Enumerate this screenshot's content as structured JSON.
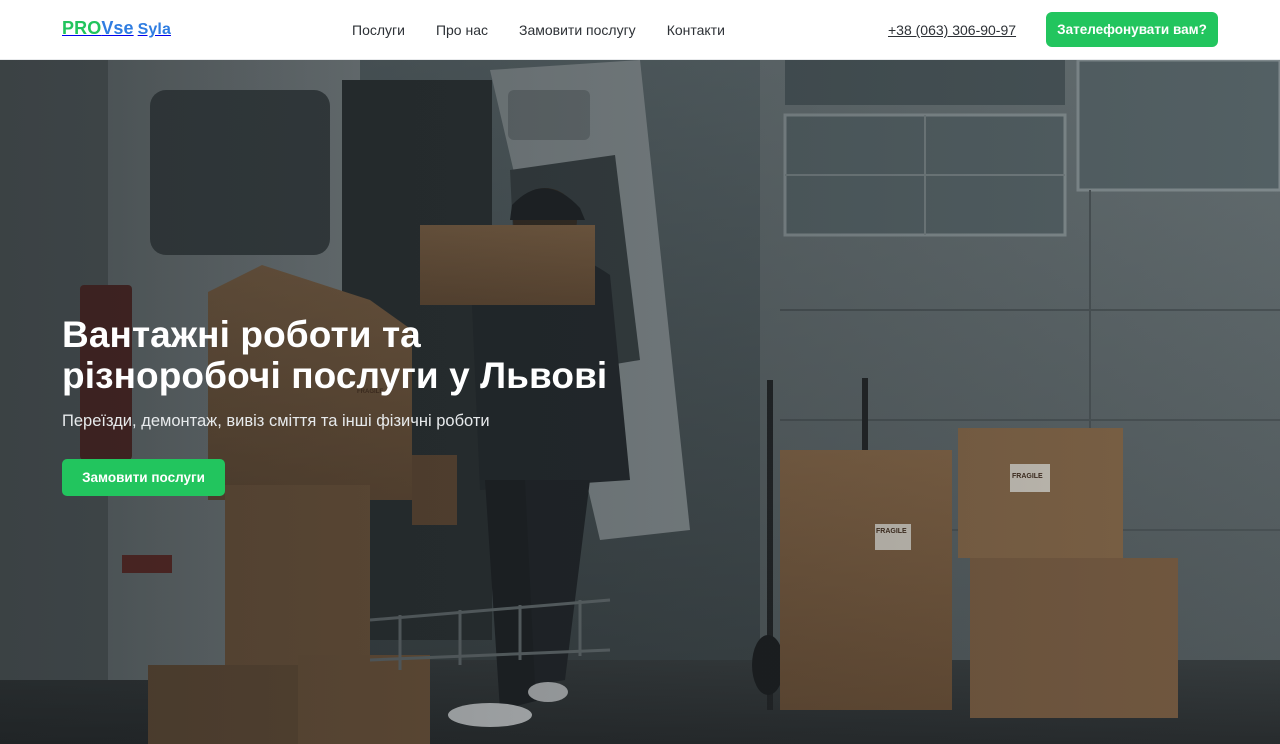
{
  "header": {
    "logo": {
      "part1": "PRO",
      "part2": "Vse",
      "part3": "Syla"
    },
    "nav": [
      {
        "label": "Послуги"
      },
      {
        "label": "Про нас"
      },
      {
        "label": "Замовити послугу"
      },
      {
        "label": "Контакти"
      }
    ],
    "phone": "+38 (063) 306-90-97",
    "call_button": "Зателефонувати вам?"
  },
  "hero": {
    "title_line1": "Вантажні роботи та",
    "title_line2": "різноробочі послуги у Львові",
    "subtitle": "Переїзди, демонтаж, вивіз сміття та інші фізичні роботи",
    "order_button": "Замовити послуги",
    "box_labels": [
      "FRAGILE",
      "FRAGILE",
      "FRAGILE"
    ]
  },
  "colors": {
    "accent_green": "#22c55e",
    "logo_blue": "#2f7de1",
    "header_bg": "#ffffff"
  }
}
